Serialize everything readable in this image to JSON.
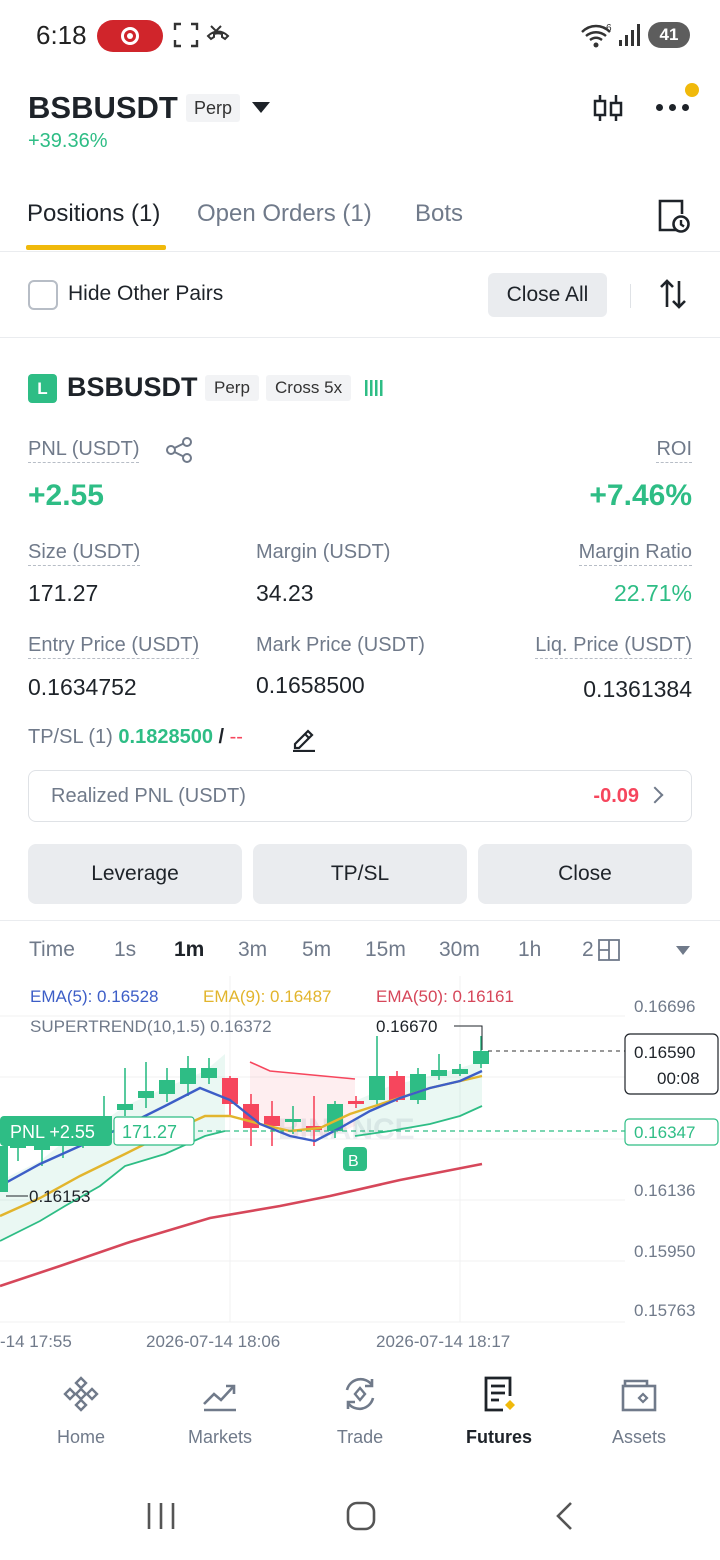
{
  "status_bar": {
    "time": "6:18",
    "battery": "41",
    "wifi_badge": "6"
  },
  "header": {
    "symbol": "BSBUSDT",
    "contract_type": "Perp",
    "change": "+39.36%"
  },
  "tabs": [
    {
      "label": "Positions (1)",
      "active": true
    },
    {
      "label": "Open Orders (1)",
      "active": false
    },
    {
      "label": "Bots",
      "active": false
    }
  ],
  "filter": {
    "hide_pairs_label": "Hide Other Pairs",
    "hide_pairs_checked": false,
    "close_all_label": "Close All"
  },
  "position": {
    "side_badge": "L",
    "symbol": "BSBUSDT",
    "contract_type": "Perp",
    "margin_mode": "Cross 5x",
    "pnl_label": "PNL (USDT)",
    "pnl_value": "+2.55",
    "roi_label": "ROI",
    "roi_value": "+7.46%",
    "size_label": "Size (USDT)",
    "size_value": "171.27",
    "margin_label": "Margin (USDT)",
    "margin_value": "34.23",
    "margin_ratio_label": "Margin Ratio",
    "margin_ratio_value": "22.71%",
    "entry_label": "Entry Price (USDT)",
    "entry_value": "0.1634752",
    "mark_label": "Mark Price (USDT)",
    "mark_value": "0.1658500",
    "liq_label": "Liq. Price (USDT)",
    "liq_value": "0.1361384",
    "tpsl_label": "TP/SL (1)",
    "tp_value": "0.1828500",
    "slash": "/",
    "sl_value": "--",
    "realized_label": "Realized PNL (USDT)",
    "realized_value": "-0.09",
    "buttons": {
      "leverage": "Leverage",
      "tpsl": "TP/SL",
      "close": "Close"
    }
  },
  "timeframes": [
    {
      "label": "Time",
      "active": false
    },
    {
      "label": "1s",
      "active": false
    },
    {
      "label": "1m",
      "active": true
    },
    {
      "label": "3m",
      "active": false
    },
    {
      "label": "5m",
      "active": false
    },
    {
      "label": "15m",
      "active": false
    },
    {
      "label": "30m",
      "active": false
    },
    {
      "label": "1h",
      "active": false
    },
    {
      "label": "2",
      "active": false
    }
  ],
  "chart": {
    "ema5": "EMA(5): 0.16528",
    "ema9": "EMA(9): 0.16487",
    "ema50": "EMA(50): 0.16161",
    "supertrend": "SUPERTREND(10,1.5) 0.16372",
    "price_axis": [
      "0.16696",
      "0.16136",
      "0.15950",
      "0.15763"
    ],
    "last_price": "0.16590",
    "countdown": "00:08",
    "entry_price_tag": "0.16347",
    "high_marker": "0.16670",
    "low_marker": "0.16153",
    "pnl_tag": "PNL +2.55",
    "pnl_size_tag": "171.27",
    "buy_marker": "B",
    "watermark": "BINANCE",
    "time_axis": [
      "-14 17:55",
      "2026-07-14 18:06",
      "2026-07-14 18:17"
    ],
    "colors": {
      "up": "#2ebd85",
      "down": "#f6465d",
      "ema5": "#3d5ec7",
      "ema9": "#e2b52d",
      "ema50": "#d6475a",
      "supertrend": "#2ebd85"
    }
  },
  "bottom_nav": [
    {
      "label": "Home",
      "icon": "binance-logo-icon",
      "active": false
    },
    {
      "label": "Markets",
      "icon": "markets-chart-icon",
      "active": false
    },
    {
      "label": "Trade",
      "icon": "trade-exchange-icon",
      "active": false
    },
    {
      "label": "Futures",
      "icon": "futures-doc-icon",
      "active": true
    },
    {
      "label": "Assets",
      "icon": "wallet-icon",
      "active": false
    }
  ]
}
